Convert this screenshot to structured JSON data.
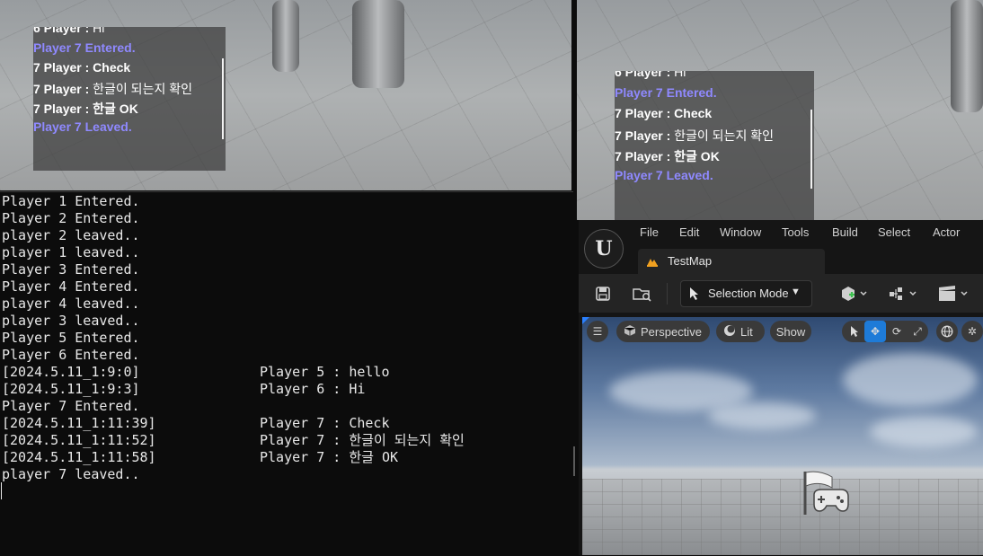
{
  "game_windows": [
    {
      "chat": [
        {
          "kind": "player",
          "name": "6 Player :",
          "text": "Hi"
        },
        {
          "kind": "system",
          "text": "Player 7 Entered."
        },
        {
          "kind": "player",
          "name": "7 Player :",
          "text": "Check"
        },
        {
          "kind": "player",
          "name": "7 Player :",
          "text": "한글이 되는지 확인"
        },
        {
          "kind": "player",
          "name": "7 Player :",
          "text": "한글 OK"
        },
        {
          "kind": "system",
          "text": "Player 7 Leaved."
        }
      ]
    },
    {
      "chat": [
        {
          "kind": "player",
          "name": "6 Player :",
          "text": "Hi"
        },
        {
          "kind": "system",
          "text": "Player 7 Entered."
        },
        {
          "kind": "player",
          "name": "7 Player :",
          "text": "Check"
        },
        {
          "kind": "player",
          "name": "7 Player :",
          "text": "한글이 되는지 확인"
        },
        {
          "kind": "player",
          "name": "7 Player :",
          "text": "한글 OK"
        },
        {
          "kind": "system",
          "text": "Player 7 Leaved."
        }
      ]
    }
  ],
  "console": {
    "lines": [
      {
        "text": "Player 1 Entered."
      },
      {
        "text": "Player 2 Entered."
      },
      {
        "text": "player 2 leaved.."
      },
      {
        "text": "player 1 leaved.."
      },
      {
        "text": "Player 3 Entered."
      },
      {
        "text": "Player 4 Entered."
      },
      {
        "text": "player 4 leaved.."
      },
      {
        "text": "player 3 leaved.."
      },
      {
        "text": "Player 5 Entered."
      },
      {
        "text": "Player 6 Entered."
      },
      {
        "text": "[2024.5.11_1:9:0]",
        "msg": "Player 5 : hello"
      },
      {
        "text": "[2024.5.11_1:9:3]",
        "msg": "Player 6 : Hi"
      },
      {
        "text": "Player 7 Entered."
      },
      {
        "text": "[2024.5.11_1:11:39]",
        "msg": "Player 7 : Check"
      },
      {
        "text": "[2024.5.11_1:11:52]",
        "msg": "Player 7 : 한글이 되는지 확인"
      },
      {
        "text": "[2024.5.11_1:11:58]",
        "msg": "Player 7 : 한글 OK"
      },
      {
        "text": "player 7 leaved.."
      }
    ]
  },
  "editor": {
    "logo": "U",
    "menu": [
      "File",
      "Edit",
      "Window",
      "Tools",
      "Build",
      "Select",
      "Actor"
    ],
    "map_tab": "TestMap",
    "toolbar": {
      "selection_mode": "Selection Mode",
      "icons": [
        "save-icon",
        "browse-icon",
        "add-actor-icon",
        "blueprint-icon",
        "cinematics-icon"
      ]
    },
    "viewport": {
      "perspective": "Perspective",
      "lit": "Lit",
      "show": "Show"
    },
    "colors": {
      "accent": "#1e7bd8",
      "system_chat": "#8f89ff",
      "map_icon": "#f0a020"
    }
  }
}
